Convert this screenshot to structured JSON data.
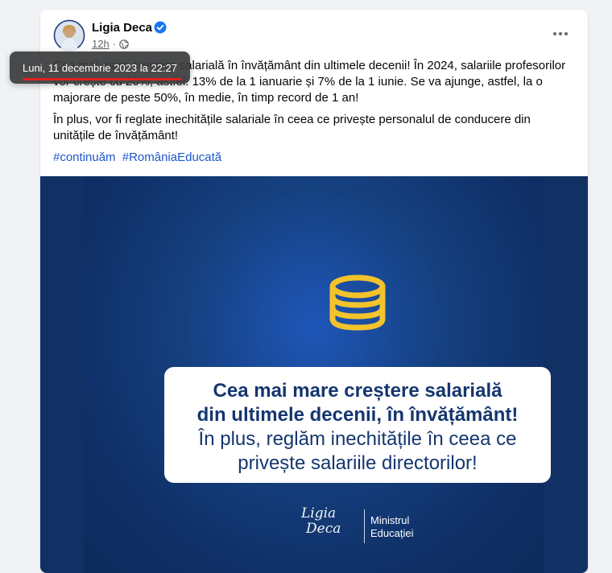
{
  "post": {
    "author": "Ligia Deca",
    "time": "12h",
    "dot": "·",
    "tooltip": "Luni, 11 decembrie 2023 la 22:27",
    "paragraph1": "Cea mai mare creștere salarială în învățământ din ultimele decenii! În 2024, salariile profesorilor vor crește cu 20%, astfel: 13% de la 1 ianuarie și 7% de la 1 iunie. Se va ajunge, astfel, la o majorare de peste 50%, în medie, în timp record de 1 an!",
    "paragraph2": "În plus, vor fi reglate inechitățile salariale în ceea ce privește personalul de conducere din unitățile de învățământ!",
    "hashtags": [
      "#continuăm",
      "#RomâniaEducată"
    ]
  },
  "image": {
    "line1": "Cea mai mare creștere salarială",
    "line2": "din ultimele decenii, în învățământ!",
    "line3": "În plus, reglăm inechitățile în ceea ce",
    "line4": "privește salariile directorilor!",
    "signature_line1": "Ligia",
    "signature_line2": "Deca",
    "institution_line1": "Ministrul",
    "institution_line2": "Educației"
  },
  "icons": {
    "more": "more-options-icon",
    "verified": "verified-badge-icon",
    "privacy": "globe-icon",
    "coins": "coins-icon"
  },
  "colors": {
    "accent_link": "#1d57c9",
    "verified": "#1877f2",
    "coin_gold": "#f3c32b",
    "image_bg": "#113063",
    "text_navy": "#15366f",
    "tooltip_underline": "#e02020"
  }
}
